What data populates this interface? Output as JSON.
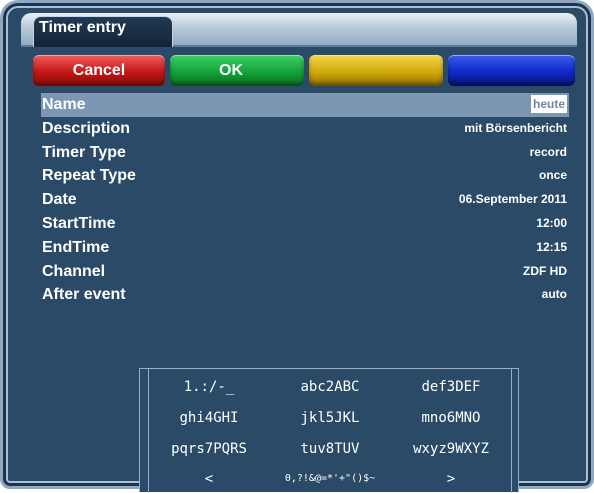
{
  "window": {
    "title": "Timer entry"
  },
  "buttons": {
    "red": "Cancel",
    "green": "OK",
    "yellow": "",
    "blue": ""
  },
  "colors": {
    "red": "#c41616",
    "green": "#14a23a",
    "yellow": "#d0a90a",
    "blue": "#1028c8",
    "selection": "#7c97b3",
    "background": "#2b4a68"
  },
  "rows": [
    {
      "label": "Name",
      "value": "heute"
    },
    {
      "label": "Description",
      "value": "mit Börsenbericht"
    },
    {
      "label": "Timer Type",
      "value": "record"
    },
    {
      "label": "Repeat Type",
      "value": "once"
    },
    {
      "label": "Date",
      "value": "06.September 2011"
    },
    {
      "label": "StartTime",
      "value": "12:00"
    },
    {
      "label": "EndTime",
      "value": "12:15"
    },
    {
      "label": "Channel",
      "value": "ZDF HD"
    },
    {
      "label": "After event",
      "value": "auto"
    }
  ],
  "keyboard": {
    "keys": [
      [
        "1.:/-_",
        "abc2ABC",
        "def3DEF"
      ],
      [
        "ghi4GHI",
        "jkl5JKL",
        "mno6MNO"
      ],
      [
        "pqrs7PQRS",
        "tuv8TUV",
        "wxyz9WXYZ"
      ],
      [
        "<",
        "0,?!&@=*'+\"()$~",
        ">"
      ]
    ]
  }
}
